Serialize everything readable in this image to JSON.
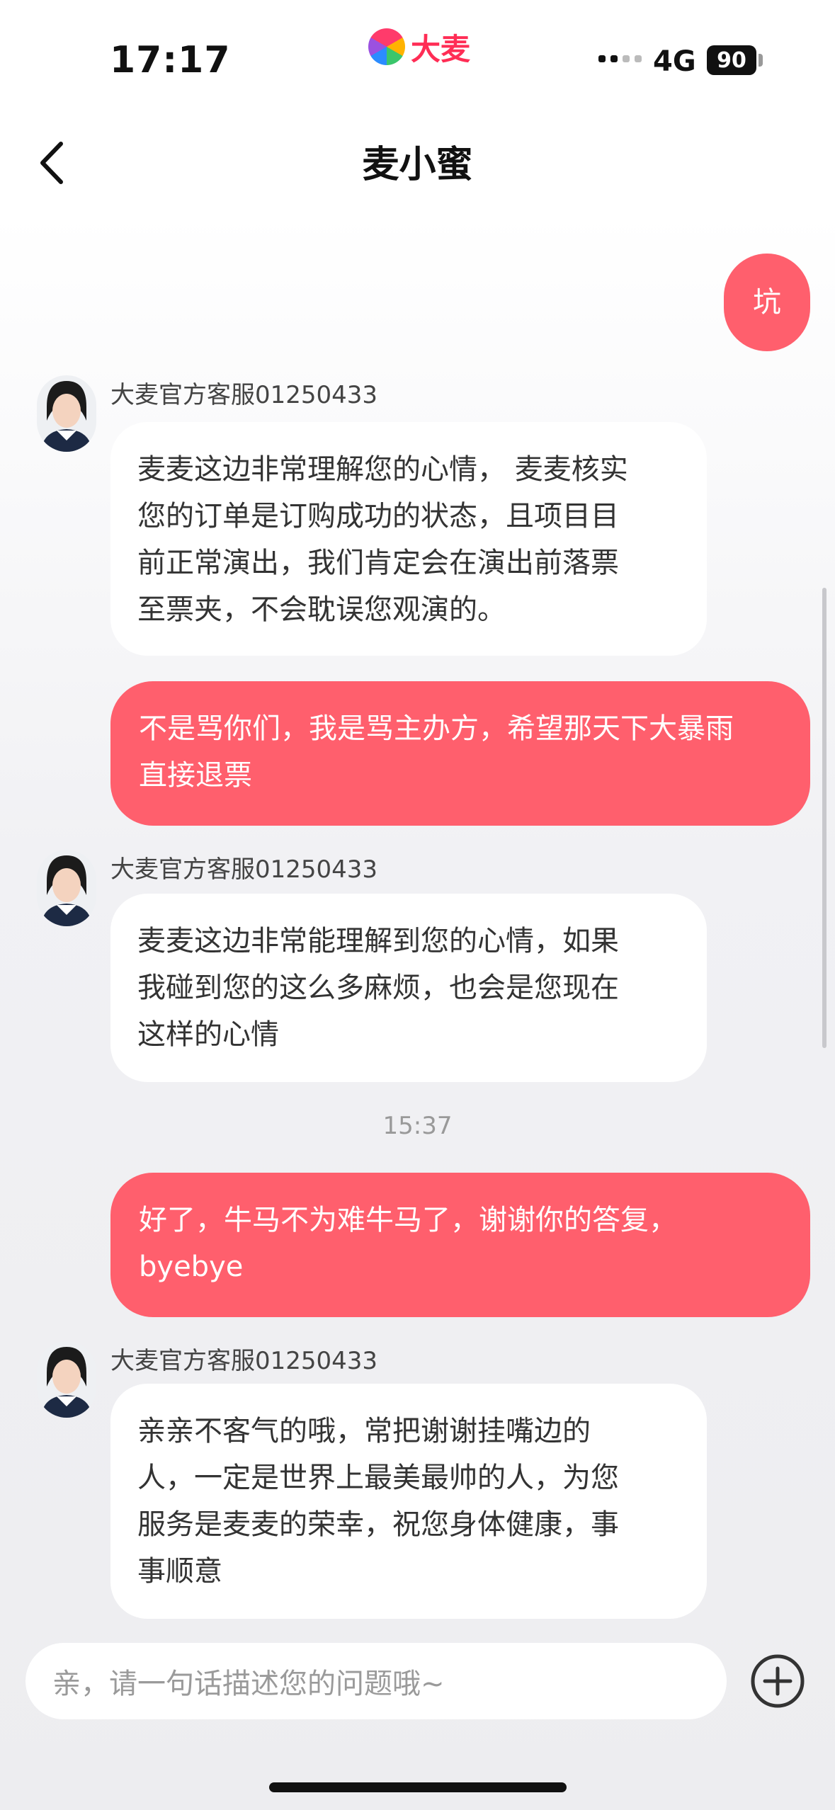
{
  "status_bar": {
    "time": "17:17",
    "logo_text": "大麦",
    "network": "4G",
    "battery": "90"
  },
  "header": {
    "title": "麦小蜜"
  },
  "messages": [
    {
      "from": "user",
      "text": "坑"
    },
    {
      "from": "agent",
      "name": "大麦官方客服01250433",
      "lines": [
        "麦麦这边非常理解您的心情， 麦麦核实",
        "您的订单是订购成功的状态，且项目目",
        "前正常演出，我们肯定会在演出前落票",
        "至票夹，不会耽误您观演的。"
      ]
    },
    {
      "from": "user",
      "lines": [
        "不是骂你们，我是骂主办方，希望那天下大暴雨",
        "直接退票"
      ]
    },
    {
      "from": "agent",
      "name": "大麦官方客服01250433",
      "lines": [
        "麦麦这边非常能理解到您的心情，如果",
        "我碰到您的这么多麻烦，也会是您现在",
        "这样的心情"
      ]
    },
    {
      "timestamp": "15:37"
    },
    {
      "from": "user",
      "lines": [
        "好了，牛马不为难牛马了，谢谢你的答复，",
        "byebye"
      ]
    },
    {
      "from": "agent",
      "name": "大麦官方客服01250433",
      "lines": [
        "亲亲不客气的哦，常把谢谢挂嘴边的",
        "人，一定是世界上最美最帅的人，为您",
        "服务是麦麦的荣幸，祝您身体健康，事",
        "事顺意"
      ]
    }
  ],
  "input": {
    "placeholder": "亲，请一句话描述您的问题哦~"
  },
  "icons": {
    "back": "chevron-left-icon",
    "add": "plus-circle-icon"
  },
  "colors": {
    "user_bubble": "#ff5f6d",
    "brand": "#ff2d55"
  }
}
